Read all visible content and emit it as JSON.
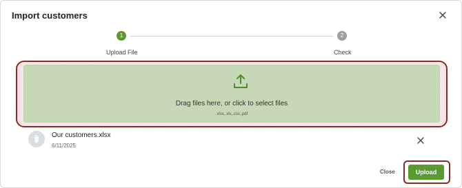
{
  "dialog": {
    "title": "Import customers",
    "close_icon": "close-icon"
  },
  "stepper": {
    "steps": [
      {
        "number": "1",
        "label": "Upload File",
        "state": "active"
      },
      {
        "number": "2",
        "label": "Check",
        "state": "inactive"
      }
    ]
  },
  "dropzone": {
    "icon": "upload-icon",
    "text": "Drag files here, or click to select files",
    "accepted": ".xlsx,.xls,.csv,.pdf"
  },
  "file": {
    "icon": "paperclip-icon",
    "name": "Our customers.xlsx",
    "date": "6/11/2025",
    "remove_icon": "close-icon"
  },
  "footer": {
    "close_label": "Close",
    "upload_label": "Upload"
  },
  "colors": {
    "accent_green": "#5a9a32",
    "inactive_gray": "#9aa0a6",
    "dropzone_bg": "#c7d8b6",
    "highlight_border": "#8a2a22"
  }
}
